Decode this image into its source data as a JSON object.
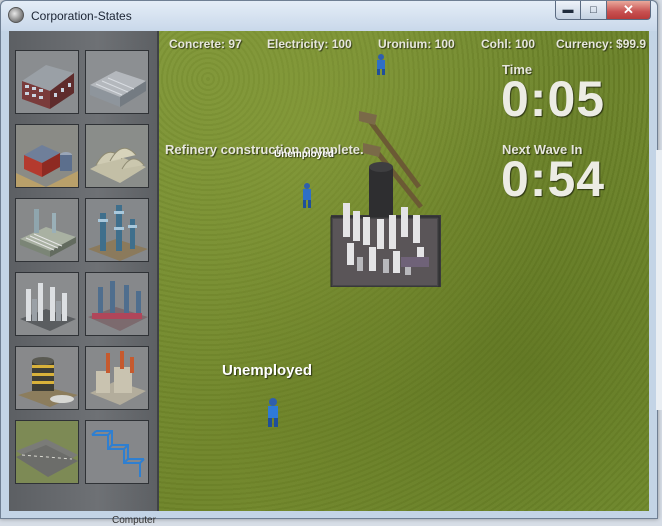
{
  "window": {
    "title": "Corporation-States"
  },
  "resources": {
    "concrete": "Concrete: 97",
    "electricity": "Electricity: 100",
    "uronium": "Uronium: 100",
    "cohl": "Cohl: 100",
    "currency": "Currency: $99.9"
  },
  "timer": {
    "label": "Time",
    "value": "0:05"
  },
  "next_wave": {
    "label": "Next Wave In",
    "value": "0:54"
  },
  "messages": {
    "construction": "Refinery construction complete."
  },
  "units": {
    "worker_label_small": "Unemployed",
    "worker_label_large": "Unemployed"
  },
  "buildings": [
    {
      "name": "apartment-tower",
      "icon": "apartment-building-icon"
    },
    {
      "name": "office-block",
      "icon": "office-block-icon"
    },
    {
      "name": "farm-barn",
      "icon": "barn-icon"
    },
    {
      "name": "concrete-plant",
      "icon": "concrete-plant-icon"
    },
    {
      "name": "power-plant",
      "icon": "power-plant-icon"
    },
    {
      "name": "tower-array",
      "icon": "tower-array-icon"
    },
    {
      "name": "refinery",
      "icon": "refinery-icon"
    },
    {
      "name": "factory",
      "icon": "factory-icon"
    },
    {
      "name": "storage-tank",
      "icon": "storage-tank-icon"
    },
    {
      "name": "smelter",
      "icon": "smelter-icon"
    },
    {
      "name": "road",
      "icon": "road-icon"
    },
    {
      "name": "scaffold",
      "icon": "scaffold-icon"
    }
  ],
  "taskbar_peek": "Computer"
}
